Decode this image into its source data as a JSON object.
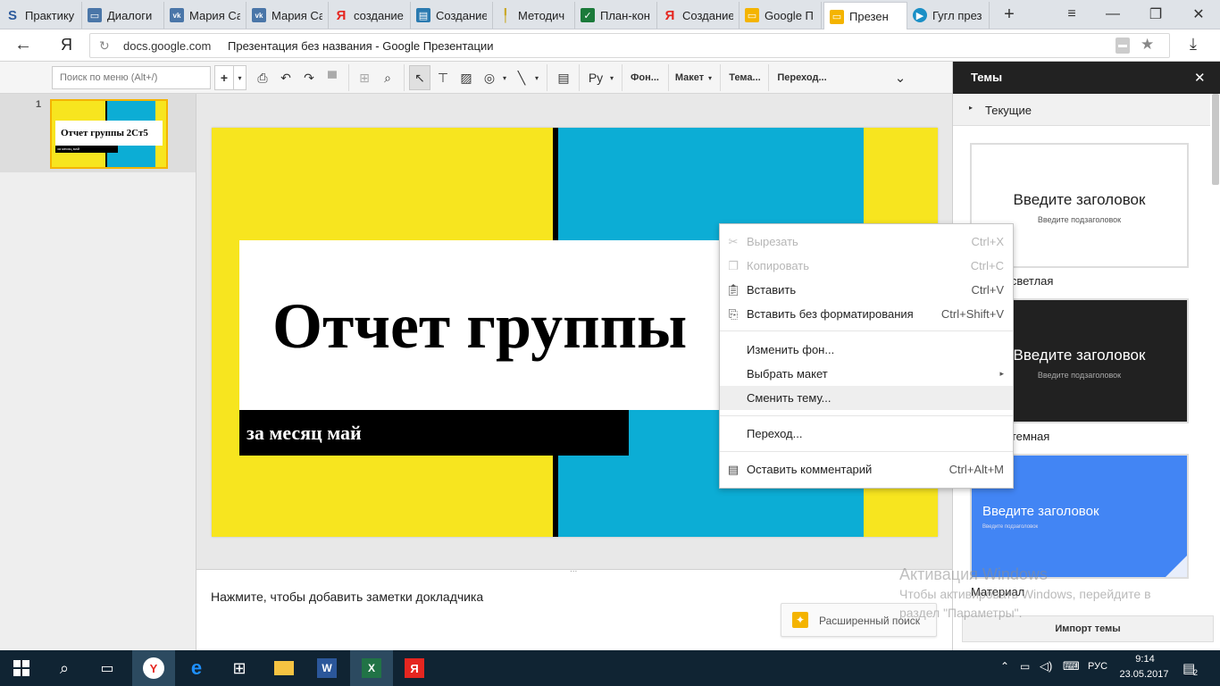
{
  "browser": {
    "tabs": [
      {
        "title": "Практику",
        "icon": "s-icon",
        "color": "#2c5a9c"
      },
      {
        "title": "Диалоги",
        "icon": "chat-icon",
        "color": "#4a76a8"
      },
      {
        "title": "Мария Са",
        "icon": "vk-icon",
        "color": "#4a76a8"
      },
      {
        "title": "Мария Са",
        "icon": "vk-icon",
        "color": "#4a76a8"
      },
      {
        "title": "создание",
        "icon": "yandex-icon",
        "color": "#e52620"
      },
      {
        "title": "Создание",
        "icon": "book-icon",
        "color": "#2a7ab0"
      },
      {
        "title": "Методич",
        "icon": "pen-icon",
        "color": "#e8c84a"
      },
      {
        "title": "План-кон",
        "icon": "check-icon",
        "color": "#1b7a3a"
      },
      {
        "title": "Создание",
        "icon": "yandex-icon",
        "color": "#e52620"
      },
      {
        "title": "Google П",
        "icon": "slides-icon",
        "color": "#f4b400"
      },
      {
        "title": "Презен",
        "icon": "slides-icon",
        "color": "#f4b400"
      },
      {
        "title": "Гугл през",
        "icon": "globe-icon",
        "color": "#1a8fc6"
      }
    ],
    "new_tab": "+",
    "address_domain": "docs.google.com",
    "address_title": "Презентация без названия - Google Презентации",
    "logo": "Я"
  },
  "toolbar": {
    "search_placeholder": "Поиск по меню (Alt+/)",
    "add": "+",
    "lang": "Ру",
    "background": "Фон...",
    "layout": "Макет",
    "theme": "Тема...",
    "transition": "Переход..."
  },
  "filmstrip": {
    "slide_number": "1",
    "thumb_title": "Отчет группы 2Ст5",
    "thumb_sub": "за месяц май"
  },
  "slide": {
    "title": "Отчет группы",
    "subtitle": "за месяц май",
    "colors": {
      "yellow": "#f7e51f",
      "cyan": "#0cadd5",
      "black": "#000000",
      "white": "#ffffff"
    }
  },
  "notes": {
    "placeholder": "Нажмите, чтобы добавить заметки докладчика",
    "advanced_search": "Расширенный поиск",
    "drag_handle": "..."
  },
  "panel": {
    "title": "Темы",
    "current": "Текущие",
    "themes": [
      {
        "heading": "Введите заголовок",
        "sub": "Введите подзаголовок",
        "name": "а светлая"
      },
      {
        "heading": "Введите заголовок",
        "sub": "Введите подзаголовок",
        "name": "а темная"
      },
      {
        "heading": "Введите заголовок",
        "sub": "Введите подзаголовок",
        "name": "Материал"
      }
    ],
    "import": "Импорт темы"
  },
  "context_menu": {
    "items": [
      {
        "label": "Вырезать",
        "shortcut": "Ctrl+X",
        "disabled": true,
        "icon": "scissors-icon"
      },
      {
        "label": "Копировать",
        "shortcut": "Ctrl+C",
        "disabled": true,
        "icon": "copy-icon"
      },
      {
        "label": "Вставить",
        "shortcut": "Ctrl+V",
        "disabled": false,
        "icon": "paste-icon"
      },
      {
        "label": "Вставить без форматирования",
        "shortcut": "Ctrl+Shift+V",
        "disabled": false,
        "icon": "paste-plain-icon"
      },
      {
        "label": "Изменить фон...",
        "shortcut": "",
        "disabled": false
      },
      {
        "label": "Выбрать макет",
        "shortcut": "▸",
        "disabled": false
      },
      {
        "label": "Сменить тему...",
        "shortcut": "",
        "disabled": false,
        "highlighted": true
      },
      {
        "label": "Переход...",
        "shortcut": "",
        "disabled": false
      },
      {
        "label": "Оставить комментарий",
        "shortcut": "Ctrl+Alt+M",
        "disabled": false,
        "icon": "comment-icon"
      }
    ]
  },
  "watermark": {
    "line1": "Активация Windows",
    "line2": "Чтобы активировать Windows, перейдите в",
    "line3": "раздел \"Параметры\"."
  },
  "taskbar": {
    "lang": "РУС",
    "time": "9:14",
    "date": "23.05.2017",
    "notification_count": "2"
  }
}
